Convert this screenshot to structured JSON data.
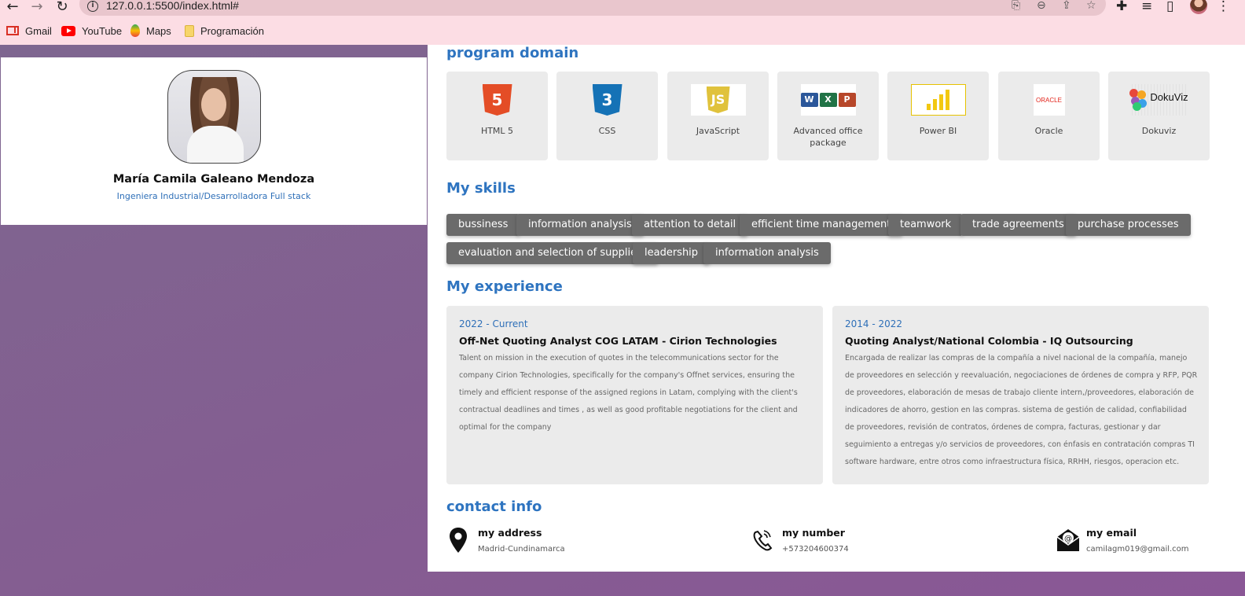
{
  "browser": {
    "url": "127.0.0.1:5500/index.html#",
    "bookmarks": [
      {
        "label": "Gmail",
        "icon": "gmail-icon"
      },
      {
        "label": "YouTube",
        "icon": "youtube-icon"
      },
      {
        "label": "Maps",
        "icon": "maps-icon"
      },
      {
        "label": "Programación",
        "icon": "folder-icon"
      }
    ]
  },
  "profile": {
    "name": "María Camila Galeano Mendoza",
    "role": "Ingeniera Industrial/Desarrolladora Full stack"
  },
  "program_domain": {
    "title": "program domain",
    "items": [
      {
        "label": "HTML 5",
        "icon": "html5-logo"
      },
      {
        "label": "CSS",
        "icon": "css3-logo"
      },
      {
        "label": "JavaScript",
        "icon": "javascript-logo"
      },
      {
        "label": "Advanced office package",
        "icon": "office-logo"
      },
      {
        "label": "Power BI",
        "icon": "powerbi-logo"
      },
      {
        "label": "Oracle",
        "icon": "oracle-logo"
      },
      {
        "label": "Dokuviz",
        "icon": "dokuviz-logo"
      }
    ],
    "logo_text": {
      "html5": "5",
      "css3": "3",
      "js": "JS",
      "oracle": "ORACLE",
      "dokuviz": "DokuViz",
      "word": "W",
      "excel": "X",
      "powerpoint": "P"
    }
  },
  "skills": {
    "title": "My skills",
    "items": [
      "bussiness",
      "information analysis",
      "attention to detail",
      "efficient time management",
      "teamwork",
      "trade agreements",
      "purchase processes",
      "evaluation and selection of suppliers",
      "leadership",
      "information analysis"
    ]
  },
  "experience": {
    "title": "My experience",
    "items": [
      {
        "years": "2022 - Current",
        "title": "Off-Net Quoting Analyst COG LATAM - Cirion Technologies",
        "description": "Talent on mission in the execution of quotes in the telecommunications sector for the company Cirion Technologies, specifically for the company's Offnet services, ensuring the timely and efficient response of the assigned regions in Latam, complying with the client's contractual deadlines and times , as well as good profitable negotiations for the client and optimal for the company"
      },
      {
        "years": "2014 - 2022",
        "title": "Quoting Analyst/National Colombia - IQ Outsourcing",
        "description": "Encargada de realizar las compras de la compañía a nivel nacional de la compañía, manejo de proveedores en selección y reevaluación, negociaciones de órdenes de compra y RFP, PQR de proveedores, elaboración de mesas de trabajo cliente intern,/proveedores, elaboración de indicadores de ahorro, gestion en las compras. sistema de gestión de calidad, confiabilidad de proveedores, revisión de contratos, órdenes de compra, facturas, gestionar y dar seguimiento a entregas y/o servicios de proveedores, con énfasis en contratación compras TI software hardware, entre otros como infraestructura física, RRHH, riesgos, operacion etc."
      }
    ]
  },
  "contact": {
    "title": "contact info",
    "items": [
      {
        "label": "my address",
        "value": "Madrid-Cundinamarca",
        "icon": "location-pin-icon"
      },
      {
        "label": "my number",
        "value": "+573204600374",
        "icon": "phone-icon"
      },
      {
        "label": "my email",
        "value": "camilagm019@gmail.com",
        "icon": "email-icon"
      }
    ]
  },
  "colors": {
    "accent": "#2e74c0",
    "tag_bg": "#6b6b6b",
    "card_bg": "#ebebeb",
    "chrome_bg": "#fcdde4"
  }
}
